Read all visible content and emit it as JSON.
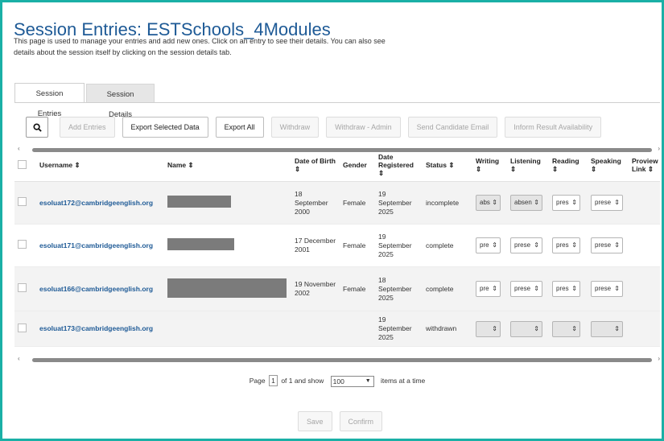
{
  "page": {
    "title": "Session Entries: ESTSchools_4Modules",
    "intro": "This page is used to manage your entries and add new ones. Click on an entry to see their details. You can also see details about the session itself by clicking on the session details tab."
  },
  "tabs": [
    {
      "label": "Session Entries",
      "active": true
    },
    {
      "label": "Session Details",
      "active": false
    }
  ],
  "toolbar": {
    "search_icon": "search-icon",
    "buttons": [
      {
        "label": "Add Entries",
        "disabled": true
      },
      {
        "label": "Export Selected Data",
        "disabled": false
      },
      {
        "label": "Export All",
        "disabled": false
      },
      {
        "label": "Withdraw",
        "disabled": true
      },
      {
        "label": "Withdraw - Admin",
        "disabled": true
      },
      {
        "label": "Send Candidate Email",
        "disabled": true
      },
      {
        "label": "Inform Result Availability",
        "disabled": true
      }
    ]
  },
  "table": {
    "headers": {
      "username": "Username ⇕",
      "name": "Name ⇕",
      "dob": "Date of Birth ⇕",
      "gender": "Gender",
      "registered": "Date Registered ⇕",
      "status": "Status ⇕",
      "writing": "Writing ⇕",
      "listening": "Listening ⇕",
      "reading": "Reading ⇕",
      "speaking": "Speaking ⇕",
      "proview": "Proview Link ⇕"
    },
    "rows": [
      {
        "username": "esoluat172@cambridgeenglish.org",
        "dob": "18 September 2000",
        "gender": "Female",
        "registered": "19 September 2025",
        "status": "incomplete",
        "writing": "abs",
        "listening": "absen",
        "reading": "pres",
        "speaking": "prese"
      },
      {
        "username": "esoluat171@cambridgeenglish.org",
        "dob": "17 December 2001",
        "gender": "Female",
        "registered": "19 September 2025",
        "status": "complete",
        "writing": "pre",
        "listening": "prese",
        "reading": "pres",
        "speaking": "prese"
      },
      {
        "username": "esoluat166@cambridgeenglish.org",
        "dob": "19 November 2002",
        "gender": "Female",
        "registered": "18 September 2025",
        "status": "complete",
        "writing": "pre",
        "listening": "prese",
        "reading": "pres",
        "speaking": "prese"
      },
      {
        "username": "esoluat173@cambridgeenglish.org",
        "dob": "",
        "gender": "",
        "registered": "19 September 2025",
        "status": "withdrawn",
        "writing": "",
        "listening": "",
        "reading": "",
        "speaking": ""
      }
    ]
  },
  "pagination": {
    "prefix": "Page",
    "page": "1",
    "of_text": "of 1 and show",
    "page_size": "100",
    "suffix": "items at a time"
  },
  "footer": {
    "save": "Save",
    "confirm": "Confirm"
  },
  "colors": {
    "accent_border": "#1ab0a6",
    "title": "#1e5a96",
    "link": "#1e5a96"
  }
}
